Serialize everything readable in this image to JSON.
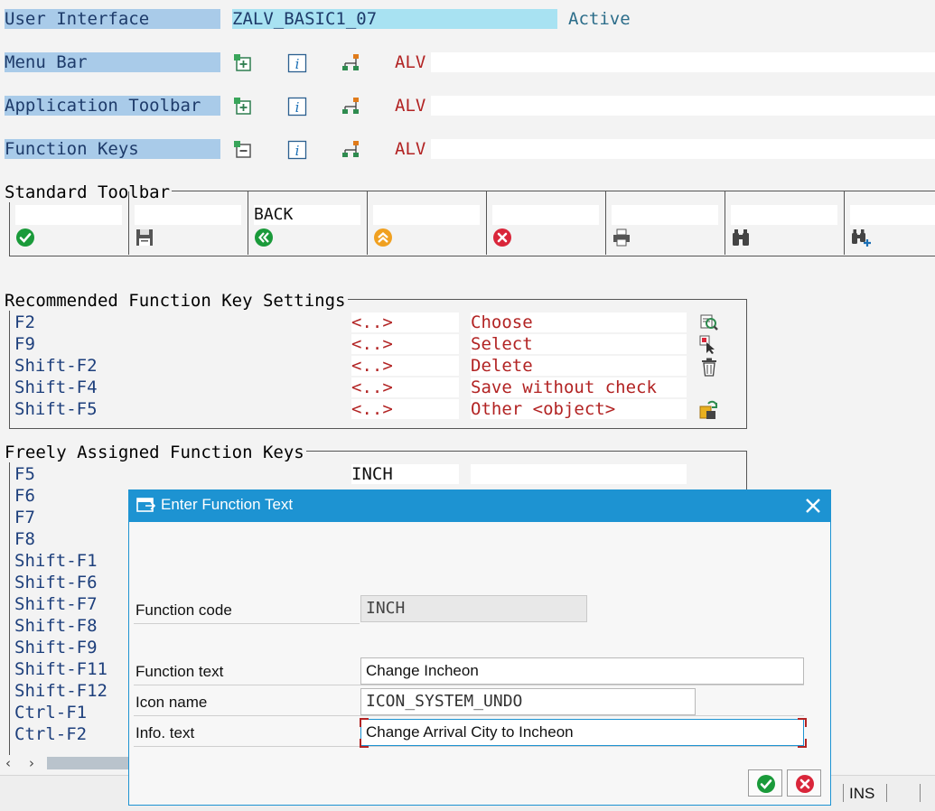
{
  "header": {
    "user_interface_label": "User Interface",
    "user_interface_value": "ZALV_BASIC1_07",
    "status": "Active"
  },
  "sections": [
    {
      "label": "Menu Bar",
      "alv": "ALV"
    },
    {
      "label": "Application Toolbar",
      "alv": "ALV"
    },
    {
      "label": "Function Keys",
      "alv": "ALV"
    }
  ],
  "standard_toolbar": {
    "title": "Standard Toolbar",
    "cells": [
      {
        "text": "",
        "icon": "check-icon"
      },
      {
        "text": "",
        "icon": "save-icon"
      },
      {
        "text": "BACK",
        "icon": "back-icon"
      },
      {
        "text": "",
        "icon": "exit-icon"
      },
      {
        "text": "",
        "icon": "cancel-icon"
      },
      {
        "text": "",
        "icon": "print-icon"
      },
      {
        "text": "",
        "icon": "find-icon"
      },
      {
        "text": "",
        "icon": "find-next-icon"
      }
    ]
  },
  "recommended": {
    "title": "Recommended Function Key Settings",
    "rows": [
      {
        "key": "F2",
        "code": "<..>",
        "text": "Choose",
        "icon": "choose-icon"
      },
      {
        "key": "F9",
        "code": "<..>",
        "text": "Select",
        "icon": "select-icon"
      },
      {
        "key": "Shift-F2",
        "code": "<..>",
        "text": "Delete",
        "icon": "trash-icon"
      },
      {
        "key": "Shift-F4",
        "code": "<..>",
        "text": "Save without check",
        "icon": ""
      },
      {
        "key": "Shift-F5",
        "code": "<..>",
        "text": "Other <object>",
        "icon": "other-object-icon"
      }
    ]
  },
  "freely": {
    "title": "Freely Assigned Function Keys",
    "first_code": "INCH",
    "keys": [
      "F5",
      "F6",
      "F7",
      "F8",
      "Shift-F1",
      "Shift-F6",
      "Shift-F7",
      "Shift-F8",
      "Shift-F9",
      "Shift-F11",
      "Shift-F12",
      "Ctrl-F1",
      "Ctrl-F2"
    ]
  },
  "dialog": {
    "title": "Enter Function Text",
    "function_code_label": "Function code",
    "function_code_value": "INCH",
    "function_text_label": "Function text",
    "function_text_value": "Change Incheon",
    "icon_name_label": "Icon name",
    "icon_name_value": "ICON_SYSTEM_UNDO",
    "info_text_label": "Info. text",
    "info_text_value": "Change Arrival City to Incheon"
  },
  "statusbar": {
    "mode": "INS"
  },
  "colors": {
    "label_blue": "#a9cbe9",
    "interface_field": "#a8e2f2",
    "dialog_header": "#1d93d2",
    "ok_green": "#1a9a3a",
    "cancel_red": "#d9263a"
  }
}
